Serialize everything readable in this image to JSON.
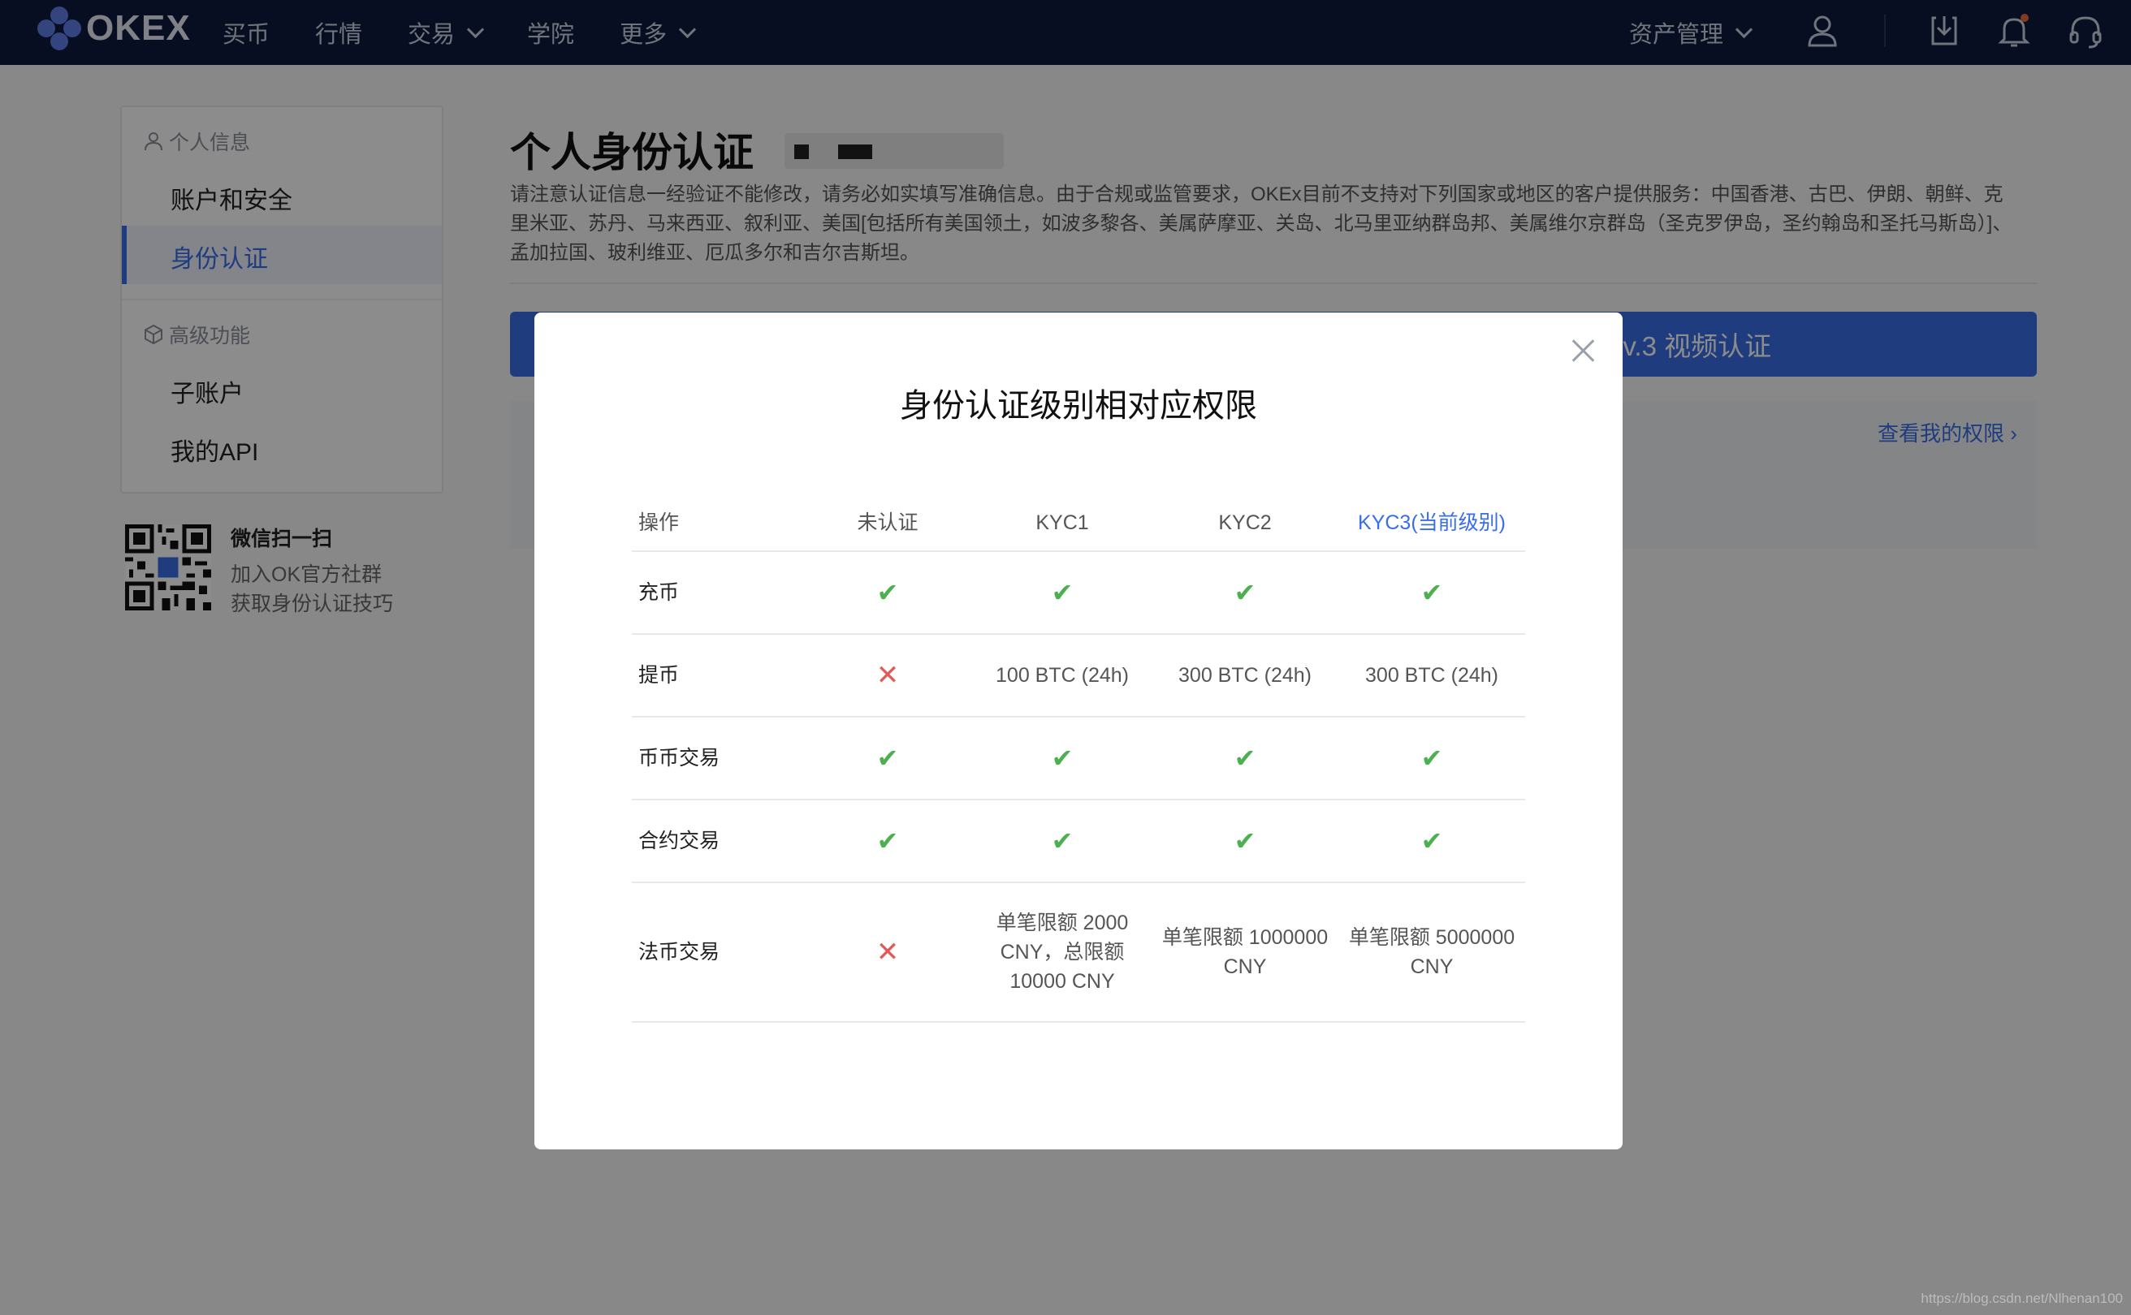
{
  "brand": {
    "name": "OKEX",
    "accent": "#3a6ee8",
    "nav_bg": "#0d1a3d"
  },
  "nav": {
    "items": [
      {
        "label": "买币",
        "dropdown": false
      },
      {
        "label": "行情",
        "dropdown": false
      },
      {
        "label": "交易",
        "dropdown": true
      },
      {
        "label": "学院",
        "dropdown": false
      },
      {
        "label": "更多",
        "dropdown": true
      }
    ],
    "asset_management": "资产管理",
    "icons": [
      "user-icon",
      "download-icon",
      "bell-icon",
      "headset-icon"
    ]
  },
  "sidebar": {
    "group1": "个人信息",
    "items1": [
      "账户和安全",
      "身份认证"
    ],
    "group2": "高级功能",
    "items2": [
      "子账户",
      "我的API"
    ]
  },
  "promo": {
    "title": "微信扫一扫",
    "line1": "加入OK官方社群",
    "line2": "获取身份认证技巧"
  },
  "page": {
    "title": "个人身份认证",
    "notice": "请注意认证信息一经验证不能修改，请务必如实填写准确信息。由于合规或监管要求，OKEx目前不支持对下列国家或地区的客户提供服务：中国香港、古巴、伊朗、朝鲜、克里米亚、苏丹、马来西亚、叙利亚、美国[包括所有美国领土，如波多黎各、美属萨摩亚、关岛、北马里亚纳群岛邦、美属维尔京群岛（圣克罗伊岛，圣约翰岛和圣托马斯岛）]、孟加拉国、玻利维亚、厄瓜多尔和吉尔吉斯坦。",
    "lv3_label": "Lv.3 视频认证",
    "view_permissions": "查看我的权限"
  },
  "modal": {
    "title": "身份认证级别相对应权限",
    "headers": [
      "操作",
      "未认证",
      "KYC1",
      "KYC2",
      "KYC3(当前级别)"
    ],
    "rows": [
      {
        "op": "充币",
        "cells": [
          {
            "type": "check"
          },
          {
            "type": "check"
          },
          {
            "type": "check"
          },
          {
            "type": "check"
          }
        ]
      },
      {
        "op": "提币",
        "cells": [
          {
            "type": "cross"
          },
          {
            "type": "text",
            "text": "100 BTC (24h)"
          },
          {
            "type": "text",
            "text": "300 BTC (24h)"
          },
          {
            "type": "text",
            "text": "300 BTC (24h)"
          }
        ]
      },
      {
        "op": "币币交易",
        "cells": [
          {
            "type": "check"
          },
          {
            "type": "check"
          },
          {
            "type": "check"
          },
          {
            "type": "check"
          }
        ]
      },
      {
        "op": "合约交易",
        "cells": [
          {
            "type": "check"
          },
          {
            "type": "check"
          },
          {
            "type": "check"
          },
          {
            "type": "check"
          }
        ]
      },
      {
        "op": "法币交易",
        "cells": [
          {
            "type": "cross"
          },
          {
            "type": "text",
            "text": "单笔限额 2000 CNY，总限额 10000 CNY"
          },
          {
            "type": "text",
            "text": "单笔限额 1000000 CNY"
          },
          {
            "type": "text",
            "text": "单笔限额 5000000 CNY"
          }
        ]
      }
    ]
  },
  "watermark": "https://blog.csdn.net/Nlhenan100"
}
